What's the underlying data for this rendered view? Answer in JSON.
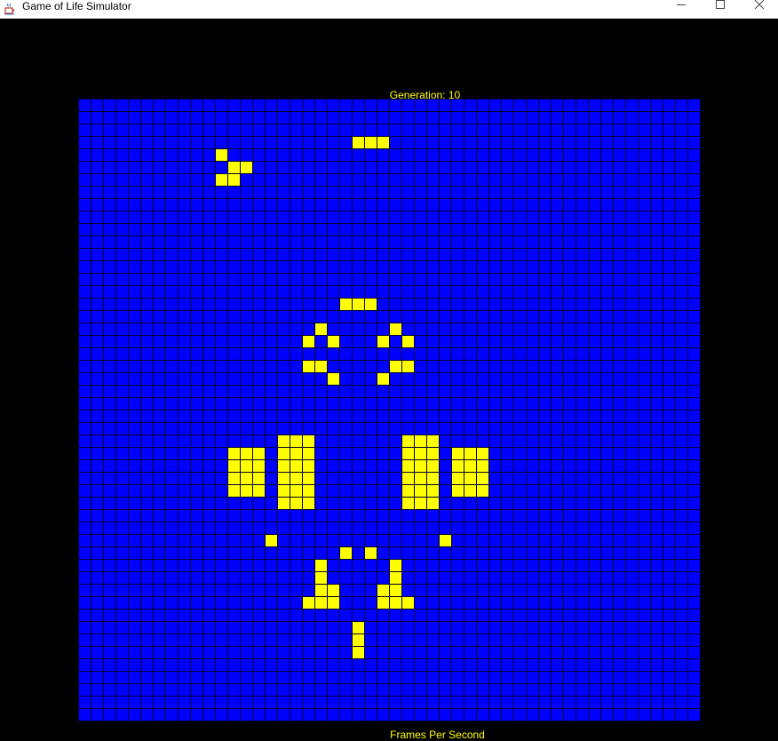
{
  "window": {
    "title": "Game of Life Simulator",
    "controls": [
      "minimize",
      "maximize",
      "close"
    ]
  },
  "simulation": {
    "generation_label": "Generation: 10",
    "fps_label": "Frames Per Second",
    "grid_columns": 50,
    "grid_rows": 50,
    "live_cells": [
      [
        22,
        3
      ],
      [
        23,
        3
      ],
      [
        24,
        3
      ],
      [
        11,
        4
      ],
      [
        12,
        5
      ],
      [
        13,
        5
      ],
      [
        11,
        6
      ],
      [
        12,
        6
      ],
      [
        21,
        16
      ],
      [
        22,
        16
      ],
      [
        23,
        16
      ],
      [
        19,
        18
      ],
      [
        25,
        18
      ],
      [
        18,
        19
      ],
      [
        20,
        19
      ],
      [
        24,
        19
      ],
      [
        26,
        19
      ],
      [
        18,
        21
      ],
      [
        19,
        21
      ],
      [
        25,
        21
      ],
      [
        26,
        21
      ],
      [
        20,
        22
      ],
      [
        24,
        22
      ],
      [
        16,
        27
      ],
      [
        17,
        27
      ],
      [
        18,
        27
      ],
      [
        26,
        27
      ],
      [
        27,
        27
      ],
      [
        28,
        27
      ],
      [
        12,
        28
      ],
      [
        13,
        28
      ],
      [
        14,
        28
      ],
      [
        16,
        28
      ],
      [
        17,
        28
      ],
      [
        18,
        28
      ],
      [
        26,
        28
      ],
      [
        27,
        28
      ],
      [
        28,
        28
      ],
      [
        30,
        28
      ],
      [
        31,
        28
      ],
      [
        32,
        28
      ],
      [
        12,
        29
      ],
      [
        13,
        29
      ],
      [
        14,
        29
      ],
      [
        16,
        29
      ],
      [
        17,
        29
      ],
      [
        18,
        29
      ],
      [
        26,
        29
      ],
      [
        27,
        29
      ],
      [
        28,
        29
      ],
      [
        30,
        29
      ],
      [
        31,
        29
      ],
      [
        32,
        29
      ],
      [
        12,
        30
      ],
      [
        13,
        30
      ],
      [
        14,
        30
      ],
      [
        16,
        30
      ],
      [
        17,
        30
      ],
      [
        18,
        30
      ],
      [
        26,
        30
      ],
      [
        27,
        30
      ],
      [
        28,
        30
      ],
      [
        30,
        30
      ],
      [
        31,
        30
      ],
      [
        32,
        30
      ],
      [
        12,
        31
      ],
      [
        13,
        31
      ],
      [
        14,
        31
      ],
      [
        16,
        31
      ],
      [
        17,
        31
      ],
      [
        18,
        31
      ],
      [
        26,
        31
      ],
      [
        27,
        31
      ],
      [
        28,
        31
      ],
      [
        30,
        31
      ],
      [
        31,
        31
      ],
      [
        32,
        31
      ],
      [
        16,
        32
      ],
      [
        17,
        32
      ],
      [
        18,
        32
      ],
      [
        26,
        32
      ],
      [
        27,
        32
      ],
      [
        28,
        32
      ],
      [
        15,
        35
      ],
      [
        29,
        35
      ],
      [
        21,
        36
      ],
      [
        23,
        36
      ],
      [
        19,
        37
      ],
      [
        25,
        37
      ],
      [
        19,
        38
      ],
      [
        25,
        38
      ],
      [
        19,
        39
      ],
      [
        20,
        39
      ],
      [
        24,
        39
      ],
      [
        25,
        39
      ],
      [
        18,
        40
      ],
      [
        19,
        40
      ],
      [
        20,
        40
      ],
      [
        24,
        40
      ],
      [
        25,
        40
      ],
      [
        26,
        40
      ],
      [
        22,
        42
      ],
      [
        22,
        43
      ],
      [
        22,
        44
      ]
    ]
  },
  "colors": {
    "background": "#000000",
    "dead_cell": "#0000ff",
    "live_cell": "#ffff00",
    "grid_line": "#000033",
    "label_text": "#ffff00"
  },
  "icons": {
    "app_icon": "java-coffee-cup-icon",
    "minimize": "minimize-icon",
    "maximize": "maximize-icon",
    "close": "close-icon"
  }
}
